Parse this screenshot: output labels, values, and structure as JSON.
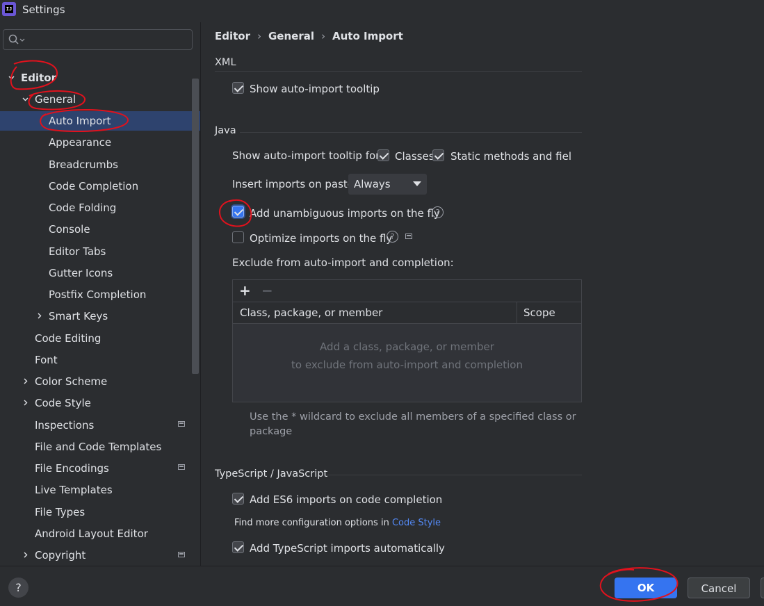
{
  "window": {
    "title": "Settings",
    "app_icon_text": "IJ"
  },
  "search": {
    "placeholder": ""
  },
  "sidebar": {
    "items": [
      {
        "label": "Editor",
        "bold": true
      },
      {
        "label": "General"
      },
      {
        "label": "Auto Import",
        "selected": true
      },
      {
        "label": "Appearance"
      },
      {
        "label": "Breadcrumbs"
      },
      {
        "label": "Code Completion"
      },
      {
        "label": "Code Folding"
      },
      {
        "label": "Console"
      },
      {
        "label": "Editor Tabs"
      },
      {
        "label": "Gutter Icons"
      },
      {
        "label": "Postfix Completion"
      },
      {
        "label": "Smart Keys"
      },
      {
        "label": "Code Editing"
      },
      {
        "label": "Font"
      },
      {
        "label": "Color Scheme"
      },
      {
        "label": "Code Style"
      },
      {
        "label": "Inspections"
      },
      {
        "label": "File and Code Templates"
      },
      {
        "label": "File Encodings"
      },
      {
        "label": "Live Templates"
      },
      {
        "label": "File Types"
      },
      {
        "label": "Android Layout Editor"
      },
      {
        "label": "Copyright"
      }
    ]
  },
  "breadcrumb": [
    "Editor",
    "General",
    "Auto Import"
  ],
  "xml": {
    "title": "XML",
    "show_tooltip": {
      "label": "Show auto-import tooltip",
      "checked": true
    }
  },
  "java": {
    "title": "Java",
    "tooltip_for_label": "Show auto-import tooltip for:",
    "classes": {
      "label": "Classes",
      "checked": true
    },
    "static_methods": {
      "label": "Static methods and fields",
      "checked": true
    },
    "insert_on_paste_label": "Insert imports on paste:",
    "insert_on_paste_value": "Always",
    "unambiguous": {
      "label": "Add unambiguous imports on the fly",
      "checked": true
    },
    "optimize": {
      "label": "Optimize imports on the fly",
      "checked": false
    },
    "exclude_label": "Exclude from auto-import and completion:",
    "table": {
      "add_symbol": "+",
      "remove_symbol": "−",
      "columns": [
        "Class, package, or member",
        "Scope"
      ],
      "empty_line1": "Add a class, package, or member",
      "empty_line2": "to exclude from auto-import and completion"
    },
    "hint": "Use the * wildcard to exclude all members of a specified class or package"
  },
  "typescript": {
    "title": "TypeScript / JavaScript",
    "es6": {
      "label": "Add ES6 imports on code completion",
      "checked": true
    },
    "more_prefix": "Find more configuration options in",
    "more_link": "Code Style",
    "ts_auto": {
      "label": "Add TypeScript imports automatically",
      "checked": true
    }
  },
  "footer": {
    "help_symbol": "?",
    "ok": "OK",
    "cancel": "Cancel"
  },
  "colors": {
    "accent": "#3574f0",
    "selection": "#2e436e",
    "annotation": "#e0121d",
    "link": "#548af7"
  }
}
